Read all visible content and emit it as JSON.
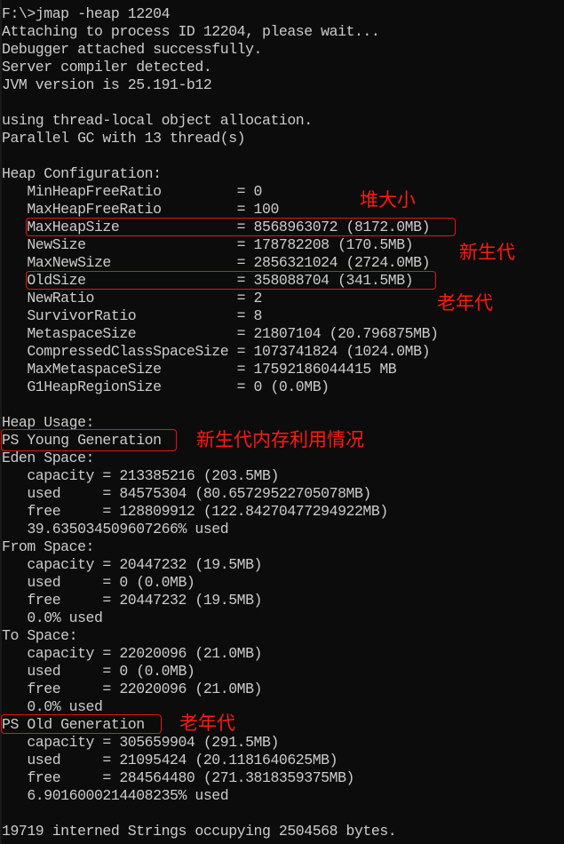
{
  "terminal": {
    "lines": [
      "F:\\>jmap -heap 12204",
      "Attaching to process ID 12204, please wait...",
      "Debugger attached successfully.",
      "Server compiler detected.",
      "JVM version is 25.191-b12",
      "",
      "using thread-local object allocation.",
      "Parallel GC with 13 thread(s)",
      "",
      "Heap Configuration:",
      "   MinHeapFreeRatio         = 0",
      "   MaxHeapFreeRatio         = 100",
      "   MaxHeapSize              = 8568963072 (8172.0MB)",
      "   NewSize                  = 178782208 (170.5MB)",
      "   MaxNewSize               = 2856321024 (2724.0MB)",
      "   OldSize                  = 358088704 (341.5MB)",
      "   NewRatio                 = 2",
      "   SurvivorRatio            = 8",
      "   MetaspaceSize            = 21807104 (20.796875MB)",
      "   CompressedClassSpaceSize = 1073741824 (1024.0MB)",
      "   MaxMetaspaceSize         = 17592186044415 MB",
      "   G1HeapRegionSize         = 0 (0.0MB)",
      "",
      "Heap Usage:",
      "PS Young Generation",
      "Eden Space:",
      "   capacity = 213385216 (203.5MB)",
      "   used     = 84575304 (80.65729522705078MB)",
      "   free     = 128809912 (122.84270477294922MB)",
      "   39.635034509607266% used",
      "From Space:",
      "   capacity = 20447232 (19.5MB)",
      "   used     = 0 (0.0MB)",
      "   free     = 20447232 (19.5MB)",
      "   0.0% used",
      "To Space:",
      "   capacity = 22020096 (21.0MB)",
      "   used     = 0 (0.0MB)",
      "   free     = 22020096 (21.0MB)",
      "   0.0% used",
      "PS Old Generation",
      "   capacity = 305659904 (291.5MB)",
      "   used     = 21095424 (20.1181640625MB)",
      "   free     = 284564480 (271.3818359375MB)",
      "   6.9016000214408235% used",
      "",
      "19719 interned Strings occupying 2504568 bytes."
    ]
  },
  "annotations": {
    "heap_size": "堆大小",
    "young_gen": "新生代",
    "old_gen": "老年代",
    "young_usage": "新生代内存利用情况",
    "old_usage": "老年代"
  },
  "colors": {
    "background": "#0c0c0c",
    "text": "#cccccc",
    "annotation": "#ff1a14"
  }
}
